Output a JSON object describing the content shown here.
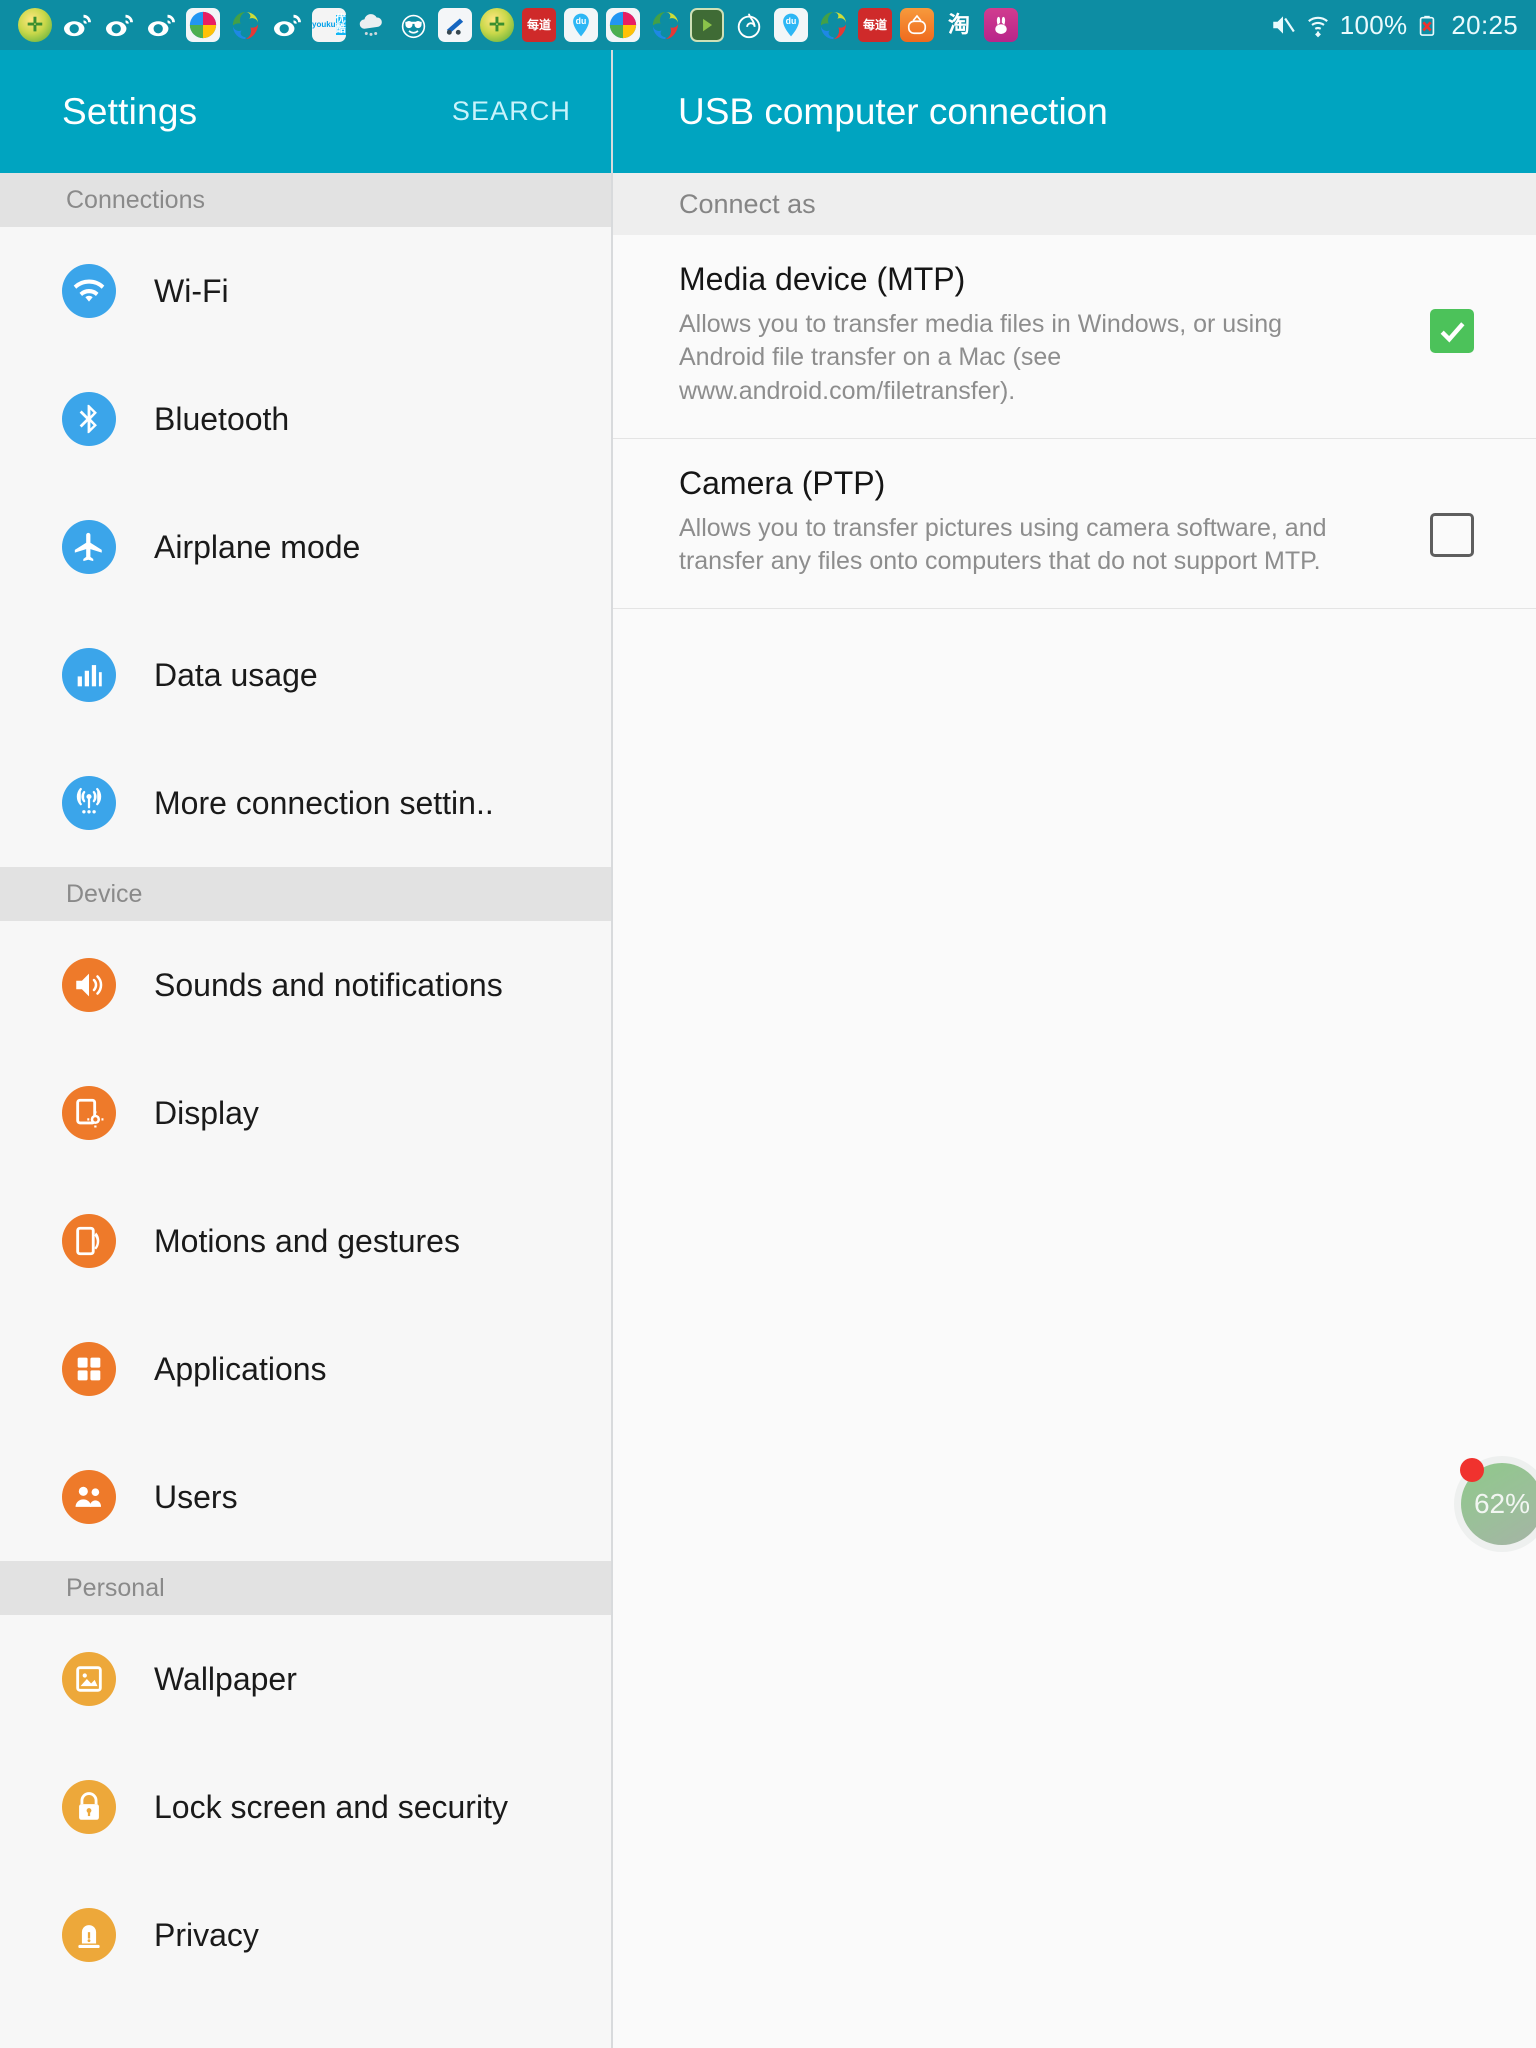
{
  "statusbar": {
    "notification_icons": [
      "360-security-icon",
      "weibo-icon",
      "weibo-icon",
      "weibo-icon",
      "rainbow-app-icon",
      "green-leaf-app-icon",
      "weibo-icon",
      "youku-icon",
      "weather-cloud-icon",
      "smiley-sunglasses-icon",
      "document-app-icon",
      "360-security-icon",
      "netease-news-icon",
      "baidu-map-icon",
      "rainbow-app-icon",
      "green-leaf-app-icon",
      "google-play-icon",
      "netease-music-icon",
      "baidu-map-icon",
      "green-leaf-app-icon",
      "netease-news-icon",
      "tv-app-icon",
      "taobao-icon",
      "rabbit-app-icon"
    ],
    "youku_top": "youku",
    "youku_bottom": "优酷",
    "netease_label": "每道",
    "baidu_label": "du",
    "taobao_label": "淘",
    "mute_icon": "mute-icon",
    "wifi_icon": "wifi-icon",
    "battery_percent": "100%",
    "battery_icon": "battery-error-icon",
    "clock": "20:25"
  },
  "sidebar": {
    "title": "Settings",
    "search_label": "SEARCH",
    "sections": [
      {
        "name": "Connections",
        "items": [
          {
            "label": "Wi-Fi",
            "icon": "wifi-icon",
            "color": "blue"
          },
          {
            "label": "Bluetooth",
            "icon": "bluetooth-icon",
            "color": "blue"
          },
          {
            "label": "Airplane mode",
            "icon": "airplane-icon",
            "color": "blue"
          },
          {
            "label": "Data usage",
            "icon": "bar-chart-icon",
            "color": "blue"
          },
          {
            "label": "More connection settin..",
            "icon": "broadcast-tower-icon",
            "color": "blue"
          }
        ]
      },
      {
        "name": "Device",
        "items": [
          {
            "label": "Sounds and notifications",
            "icon": "speaker-icon",
            "color": "orange"
          },
          {
            "label": "Display",
            "icon": "display-brightness-icon",
            "color": "orange"
          },
          {
            "label": "Motions and gestures",
            "icon": "motion-gesture-icon",
            "color": "orange"
          },
          {
            "label": "Applications",
            "icon": "grid-apps-icon",
            "color": "orange"
          },
          {
            "label": "Users",
            "icon": "users-icon",
            "color": "orange"
          }
        ]
      },
      {
        "name": "Personal",
        "items": [
          {
            "label": "Wallpaper",
            "icon": "image-icon",
            "color": "amber"
          },
          {
            "label": "Lock screen and security",
            "icon": "lock-icon",
            "color": "amber"
          },
          {
            "label": "Privacy",
            "icon": "privacy-alert-icon",
            "color": "amber"
          }
        ]
      }
    ]
  },
  "detail": {
    "title": "USB computer connection",
    "section_label": "Connect as",
    "options": [
      {
        "title": "Media device (MTP)",
        "desc": "Allows you to transfer media files in Windows, or using Android file transfer on a Mac (see www.android.com/filetransfer).",
        "checked": true
      },
      {
        "title": "Camera (PTP)",
        "desc": "Allows you to transfer pictures using camera software, and transfer any files onto computers that do not support MTP.",
        "checked": false
      }
    ]
  },
  "floating_badge": {
    "value": "62%",
    "has_alert_dot": true
  },
  "colors": {
    "accent": "#00a4c0",
    "statusbar": "#0d8da3",
    "checkbox_on": "#4cc25a",
    "icon_blue": "#3ba5ea",
    "icon_orange": "#ee7a2a",
    "icon_amber": "#eda83a",
    "alert_dot": "#f0322e"
  }
}
